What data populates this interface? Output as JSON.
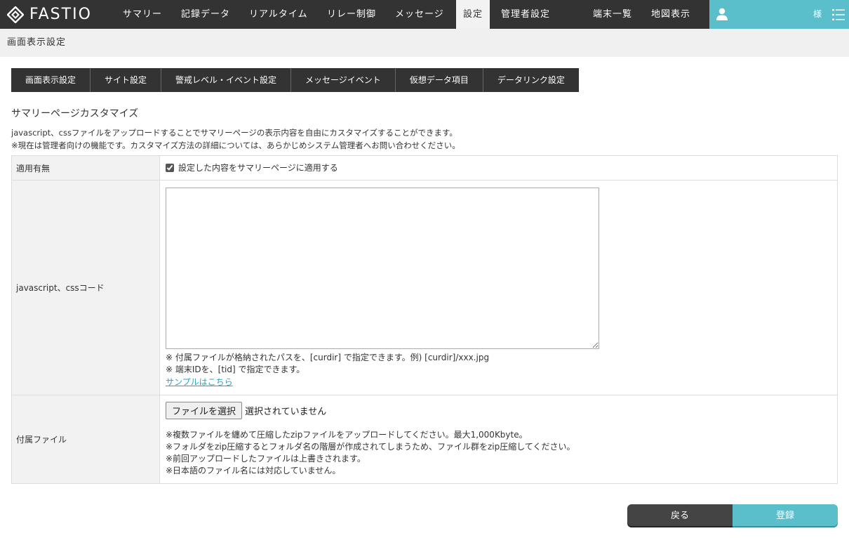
{
  "app": {
    "logo_text": "FASTIO"
  },
  "nav": {
    "items": [
      {
        "label": "サマリー",
        "active": false
      },
      {
        "label": "記録データ",
        "active": false
      },
      {
        "label": "リアルタイム",
        "active": false
      },
      {
        "label": "リレー制御",
        "active": false
      },
      {
        "label": "メッセージ",
        "active": false
      },
      {
        "label": "設定",
        "active": true
      },
      {
        "label": "管理者設定",
        "active": false
      }
    ],
    "right_items": [
      {
        "label": "端末一覧"
      },
      {
        "label": "地図表示"
      }
    ],
    "user_suffix": "様"
  },
  "page": {
    "title": "画面表示設定"
  },
  "tabs": [
    {
      "label": "画面表示設定"
    },
    {
      "label": "サイト設定"
    },
    {
      "label": "警戒レベル・イベント設定"
    },
    {
      "label": "メッセージイベント"
    },
    {
      "label": "仮想データ項目"
    },
    {
      "label": "データリンク設定"
    }
  ],
  "section": {
    "title": "サマリーページカスタマイズ",
    "desc_line1": "javascript、cssファイルをアップロードすることでサマリーページの表示内容を自由にカスタマイズすることができます。",
    "desc_line2": "※現在は管理者向けの機能です。カスタマイズ方法の詳細については、あらかじめシステム管理者へお問い合わせください。"
  },
  "form": {
    "apply": {
      "label": "適用有無",
      "checkbox_label": "設定した内容をサマリーページに適用する",
      "checked": true
    },
    "code": {
      "label": "javascript、cssコード",
      "value": "",
      "note1": "※ 付属ファイルが格納されたパスを、[curdir] で指定できます。例) [curdir]/xxx.jpg",
      "note2": "※ 端末IDを、[tid] で指定できます。",
      "sample_link": "サンプルはこちら"
    },
    "attachment": {
      "label": "付属ファイル",
      "button_label": "ファイルを選択",
      "status": "選択されていません",
      "note1": "※複数ファイルを纏めて圧縮したzipファイルをアップロードしてください。最大1,000Kbyte。",
      "note2": "※フォルダをzip圧縮するとフォルダ名の階層が作成されてしまうため、ファイル群をzip圧縮してください。",
      "note3": "※前回アップロードしたファイルは上書きされます。",
      "note4": "※日本語のファイル名には対応していません。"
    }
  },
  "actions": {
    "back_label": "戻る",
    "save_label": "登録"
  },
  "colors": {
    "nav_bg": "#333333",
    "accent": "#5bbfcb",
    "link": "#2aa3c8"
  },
  "icons": {
    "logo": "diamond-logo-icon",
    "user": "user-icon",
    "menu": "list-menu-icon"
  }
}
